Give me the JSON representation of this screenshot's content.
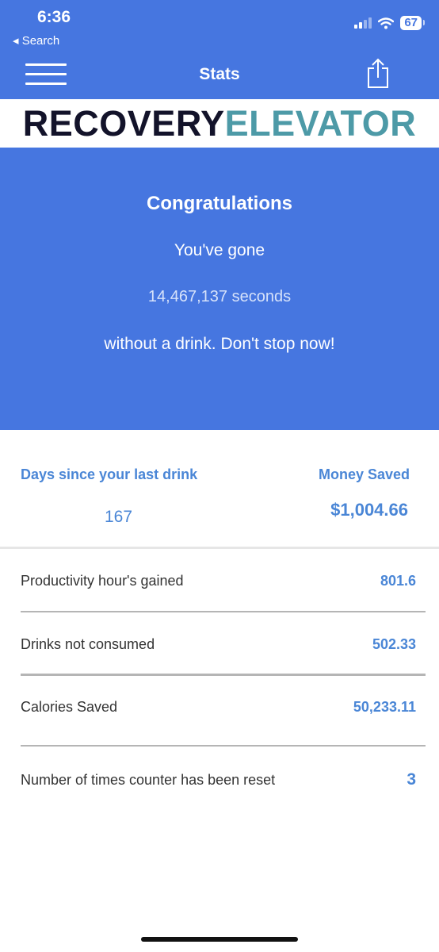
{
  "status_bar": {
    "time": "6:36",
    "back_label": "◂ Search",
    "battery": "67"
  },
  "nav": {
    "title": "Stats"
  },
  "brand": {
    "part1": "RECOVERY",
    "part2": "ELEVATOR"
  },
  "hero": {
    "title": "Congratulations",
    "line1": "You've gone",
    "seconds": "14,467,137 seconds",
    "line2": "without a drink. Don't stop now!"
  },
  "summary": {
    "days_label": "Days since your last drink",
    "days_value": "167",
    "money_label": "Money Saved",
    "money_value": "$1,004.66"
  },
  "stats": [
    {
      "label": "Productivity hour's gained",
      "value": "801.6"
    },
    {
      "label": "Drinks not consumed",
      "value": "502.33"
    },
    {
      "label": "Calories Saved",
      "value": "50,233.11"
    },
    {
      "label": "Number of times counter has been reset",
      "value": "3"
    }
  ],
  "colors": {
    "primary_blue": "#4676e0",
    "accent_blue": "#4a86d6",
    "brand_dark": "#13132a",
    "brand_teal": "#4d9aa7"
  },
  "icons": [
    "signal-icon",
    "wifi-icon",
    "battery-icon",
    "hamburger-menu-icon",
    "share-icon"
  ]
}
